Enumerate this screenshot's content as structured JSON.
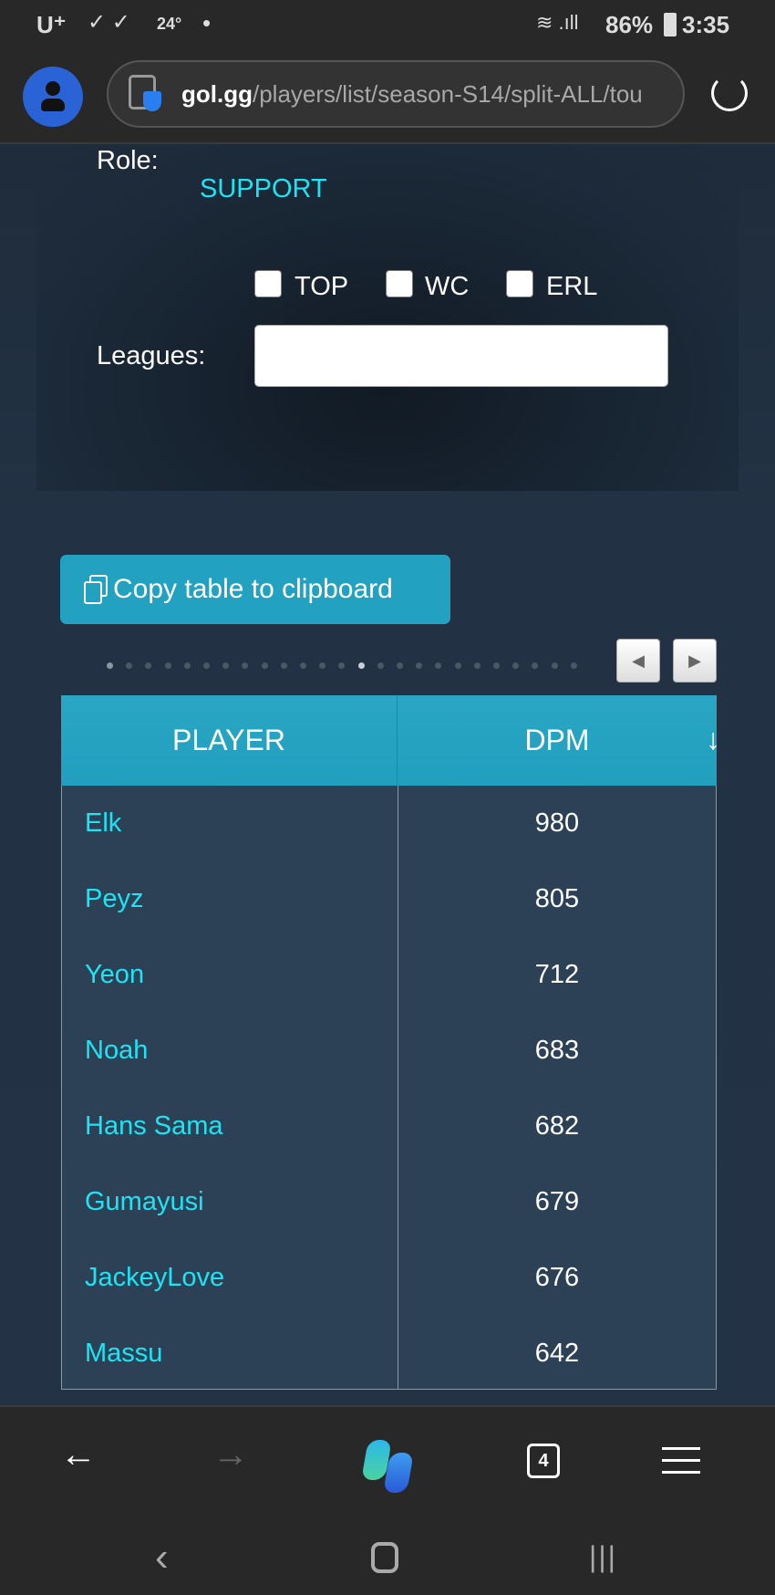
{
  "status_bar": {
    "carrier": "U⁺",
    "temperature": "24°",
    "battery": "86%",
    "time": "3:35"
  },
  "browser": {
    "url_domain": "gol.gg",
    "url_path": "/players/list/season-S14/split-ALL/tou",
    "tab_count": "4"
  },
  "filters": {
    "role_label": "Role:",
    "role_value": "SUPPORT",
    "leagues_label": "Leagues:",
    "leagues_value": "",
    "checkboxes": [
      {
        "label": "TOP",
        "checked": false
      },
      {
        "label": "WC",
        "checked": false
      },
      {
        "label": "ERL",
        "checked": false
      }
    ]
  },
  "copy_button": "Copy table to clipboard",
  "pagination": {
    "dot_count": 25,
    "active_dot": 13
  },
  "table": {
    "headers": [
      "PLAYER",
      "DPM"
    ],
    "sort_indicator": "↓",
    "rows": [
      [
        "Elk",
        "980"
      ],
      [
        "Peyz",
        "805"
      ],
      [
        "Yeon",
        "712"
      ],
      [
        "Noah",
        "683"
      ],
      [
        "Hans Sama",
        "682"
      ],
      [
        "Gumayusi",
        "679"
      ],
      [
        "JackeyLove",
        "676"
      ],
      [
        "Massu",
        "642"
      ]
    ]
  },
  "colors": {
    "accent": "#22a1c0",
    "link": "#1de4f4",
    "background": "#233244"
  }
}
